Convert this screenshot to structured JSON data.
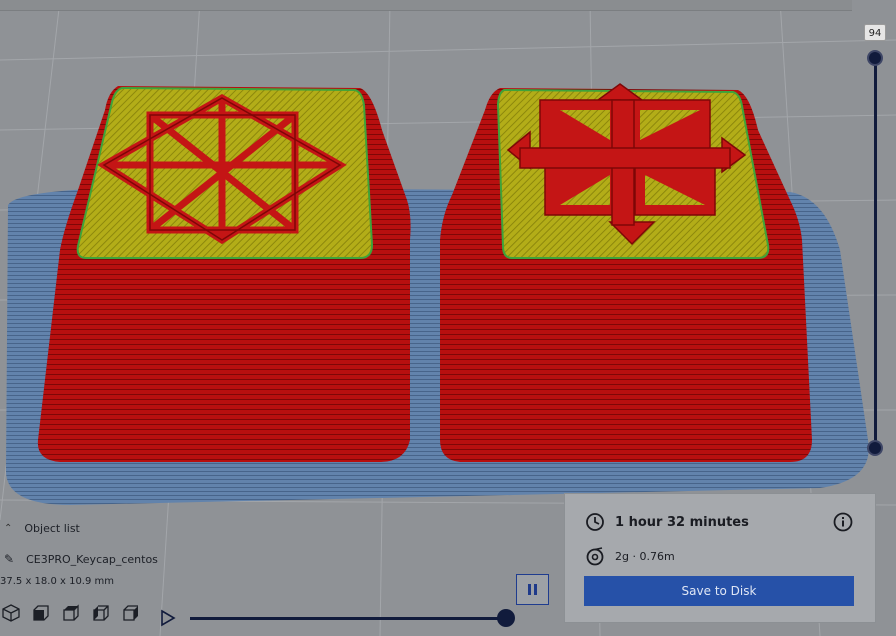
{
  "layer_slider": {
    "current_layer": "94"
  },
  "object_panel": {
    "toggle_label": "Object list",
    "object_name": "CE3PRO_Keycap_centos",
    "dimensions": "37.5 x 18.0 x 10.9 mm"
  },
  "print_info": {
    "print_time": "1 hour 32 minutes",
    "material": "2g · 0.76m",
    "save_label": "Save to Disk"
  },
  "view_buttons": [
    "3d-view",
    "front-view",
    "top-view",
    "left-view",
    "right-view"
  ],
  "simulation": {
    "progress": 1.0,
    "state": "paused"
  },
  "colors": {
    "wall": "#b91010",
    "top_skin": "#b6b11a",
    "outline": "#3fa33a",
    "build_plate_brim": "#5e7fa8",
    "accent": "#2651a8",
    "slider": "#111b3c"
  }
}
